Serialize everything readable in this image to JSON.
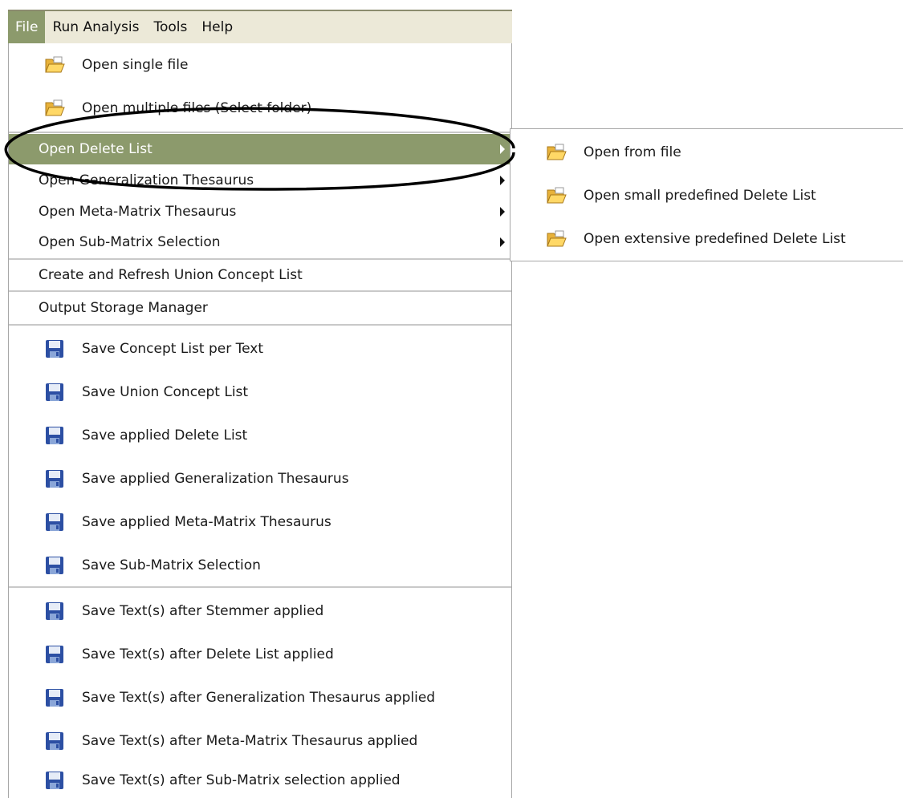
{
  "menubar": {
    "items": [
      {
        "label": "File",
        "active": true
      },
      {
        "label": "Run Analysis"
      },
      {
        "label": "Tools"
      },
      {
        "label": "Help"
      }
    ]
  },
  "file_menu": {
    "open_single_file": {
      "label": "Open single file",
      "icon": "folder-open-icon"
    },
    "open_multiple_files": {
      "label": "Open multiple files (Select folder)",
      "icon": "folder-open-icon"
    },
    "open_delete_list": {
      "label": "Open Delete List",
      "has_submenu": true,
      "highlighted": true
    },
    "open_generalization_thesaurus": {
      "label": "Open Generalization Thesaurus",
      "has_submenu": true
    },
    "open_meta_matrix_thesaurus": {
      "label": "Open Meta-Matrix Thesaurus",
      "has_submenu": true
    },
    "open_sub_matrix_selection": {
      "label": "Open Sub-Matrix Selection",
      "has_submenu": true
    },
    "create_union_concept_list": {
      "label": "Create and Refresh Union Concept List"
    },
    "output_storage_manager": {
      "label": "Output Storage Manager"
    },
    "save_concept_list_per_text": {
      "label": "Save Concept List per Text",
      "icon": "floppy-disk-icon"
    },
    "save_union_concept_list": {
      "label": "Save Union Concept List",
      "icon": "floppy-disk-icon"
    },
    "save_applied_delete_list": {
      "label": "Save applied Delete List",
      "icon": "floppy-disk-icon"
    },
    "save_applied_generalization_thesaurus": {
      "label": "Save applied Generalization Thesaurus",
      "icon": "floppy-disk-icon"
    },
    "save_applied_meta_matrix_thesaurus": {
      "label": "Save applied Meta-Matrix Thesaurus",
      "icon": "floppy-disk-icon"
    },
    "save_sub_matrix_selection": {
      "label": "Save Sub-Matrix Selection",
      "icon": "floppy-disk-icon"
    },
    "save_text_after_stemmer": {
      "label": "Save Text(s) after Stemmer applied",
      "icon": "floppy-disk-icon"
    },
    "save_text_after_delete_list": {
      "label": "Save Text(s) after Delete List applied",
      "icon": "floppy-disk-icon"
    },
    "save_text_after_generalization": {
      "label": "Save Text(s) after Generalization Thesaurus applied",
      "icon": "floppy-disk-icon"
    },
    "save_text_after_meta_matrix": {
      "label": "Save Text(s) after Meta-Matrix Thesaurus applied",
      "icon": "floppy-disk-icon"
    },
    "save_text_after_sub_matrix": {
      "label": "Save Text(s) after Sub-Matrix selection applied",
      "icon": "floppy-disk-icon"
    }
  },
  "delete_list_submenu": {
    "open_from_file": {
      "label": "Open from file",
      "icon": "folder-open-icon"
    },
    "open_small_predefined": {
      "label": "Open small predefined Delete List",
      "icon": "folder-open-icon"
    },
    "open_extensive_predefined": {
      "label": "Open extensive predefined Delete List",
      "icon": "folder-open-icon"
    }
  },
  "colors": {
    "highlight": "#8c9a6c",
    "menubar_bg": "#ece9d8",
    "annotation_ellipse": "#000000"
  }
}
